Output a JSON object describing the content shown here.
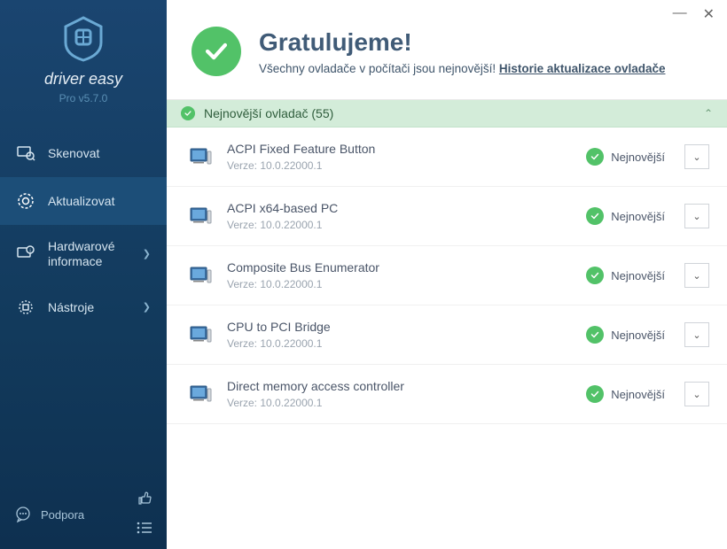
{
  "brand": {
    "name": "driver easy",
    "tagline": "Pro v5.7.0"
  },
  "sidebar": {
    "items": [
      {
        "label": "Skenovat"
      },
      {
        "label": "Aktualizovat"
      },
      {
        "label": "Hardwarové informace"
      },
      {
        "label": "Nástroje"
      }
    ],
    "support_label": "Podpora"
  },
  "header": {
    "title": "Gratulujeme!",
    "subtitle_prefix": "Všechny ovladače v počítači jsou nejnovější! ",
    "history_link": "Historie aktualizace ovladače"
  },
  "section": {
    "label": "Nejnovější ovladač (55)"
  },
  "status_label": "Nejnovější",
  "version_prefix": "Verze: ",
  "drivers": [
    {
      "name": "ACPI Fixed Feature Button",
      "version": "10.0.22000.1"
    },
    {
      "name": "ACPI x64-based PC",
      "version": "10.0.22000.1"
    },
    {
      "name": "Composite Bus Enumerator",
      "version": "10.0.22000.1"
    },
    {
      "name": "CPU to PCI Bridge",
      "version": "10.0.22000.1"
    },
    {
      "name": "Direct memory access controller",
      "version": "10.0.22000.1"
    }
  ]
}
